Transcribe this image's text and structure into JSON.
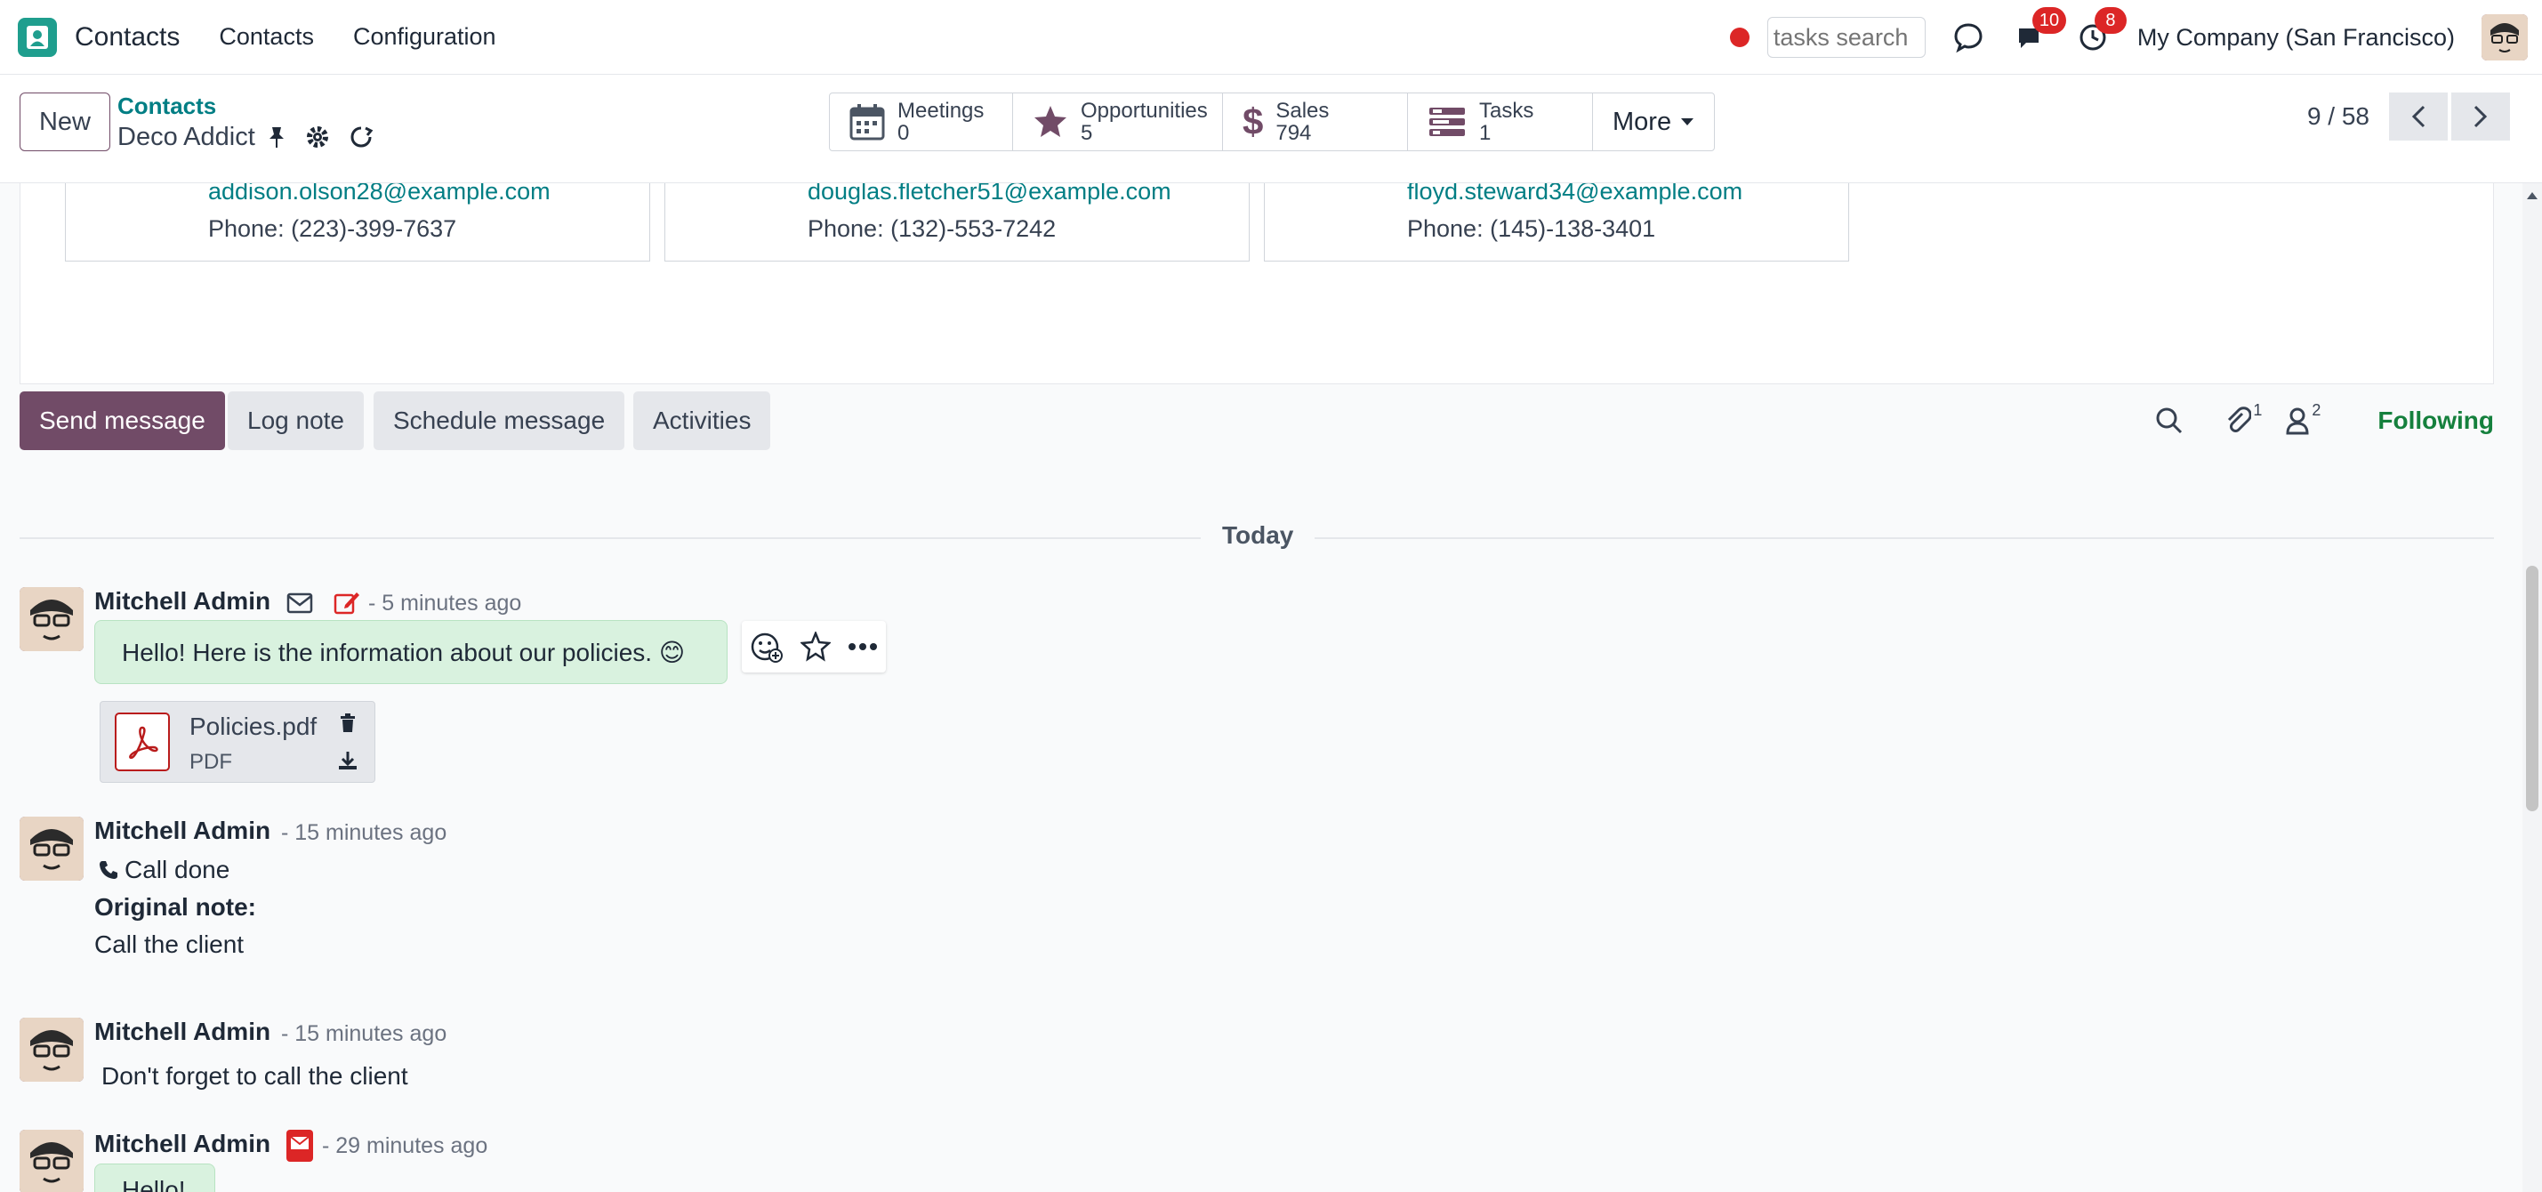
{
  "navbar": {
    "app_name": "Contacts",
    "menu": [
      "Contacts",
      "Configuration"
    ],
    "search_placeholder": "tasks search",
    "messages_badge": "10",
    "activities_badge": "8",
    "company": "My Company (San Francisco)"
  },
  "control": {
    "new_label": "New",
    "breadcrumb_parent": "Contacts",
    "breadcrumb_current": "Deco Addict",
    "smart_buttons": [
      {
        "label": "Meetings",
        "value": "0"
      },
      {
        "label": "Opportunities",
        "value": "5"
      },
      {
        "label": "Sales",
        "value": "794"
      },
      {
        "label": "Tasks",
        "value": "1"
      }
    ],
    "more_label": "More",
    "pager": "9 / 58"
  },
  "contacts": [
    {
      "email": "addison.olson28@example.com",
      "phone": "Phone: (223)-399-7637"
    },
    {
      "email": "douglas.fletcher51@example.com",
      "phone": "Phone: (132)-553-7242"
    },
    {
      "email": "floyd.steward34@example.com",
      "phone": "Phone: (145)-138-3401"
    }
  ],
  "chatter": {
    "send_message": "Send message",
    "log_note": "Log note",
    "schedule_message": "Schedule message",
    "activities": "Activities",
    "attachments_count": "1",
    "followers_count": "2",
    "following": "Following",
    "today": "Today"
  },
  "messages": [
    {
      "author": "Mitchell Admin",
      "time": "- 5 minutes ago",
      "body": "Hello! Here is the information about our policies. 😊",
      "attachment_name": "Policies.pdf",
      "attachment_type": "PDF"
    },
    {
      "author": "Mitchell Admin",
      "time": "- 15 minutes ago",
      "line1": "Call done",
      "line2": "Original note:",
      "line3": "Call the client"
    },
    {
      "author": "Mitchell Admin",
      "time": "- 15 minutes ago",
      "line1": "Don't forget to call the client"
    },
    {
      "author": "Mitchell Admin",
      "time": "- 29 minutes ago",
      "body": "Hello!"
    }
  ],
  "colors": {
    "brand": "#714b67",
    "link": "#017e84",
    "following": "#15803d",
    "badge": "#dc2626"
  }
}
